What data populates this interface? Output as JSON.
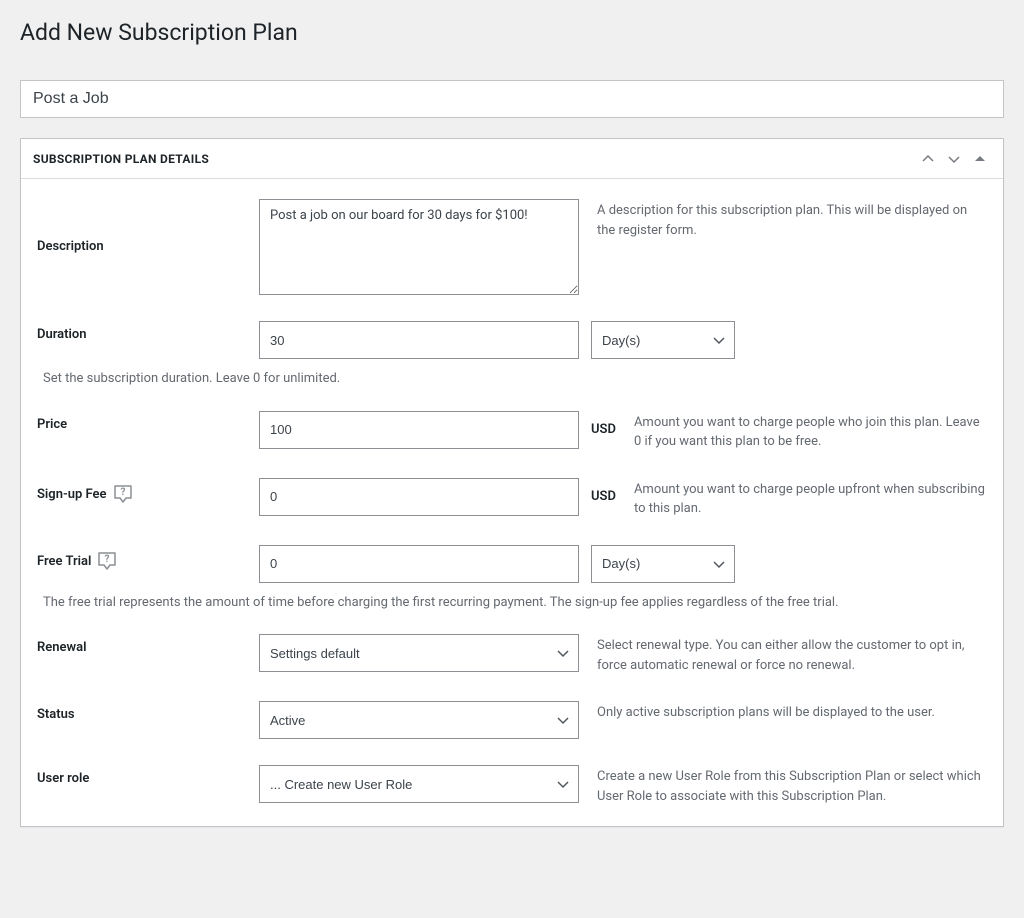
{
  "page": {
    "title": "Add New Subscription Plan"
  },
  "title_field": {
    "value": "Post a Job"
  },
  "panel": {
    "heading": "SUBSCRIPTION PLAN DETAILS"
  },
  "fields": {
    "description": {
      "label": "Description",
      "value": "Post a job on our board for 30 days for $100!",
      "help": "A description for this subscription plan. This will be displayed on the register form."
    },
    "duration": {
      "label": "Duration",
      "value": "30",
      "unit": "Day(s)",
      "subhelp": "Set the subscription duration. Leave 0 for unlimited."
    },
    "price": {
      "label": "Price",
      "value": "100",
      "currency": "USD",
      "help": "Amount you want to charge people who join this plan. Leave 0 if you want this plan to be free."
    },
    "signup_fee": {
      "label": "Sign-up Fee",
      "value": "0",
      "currency": "USD",
      "help": "Amount you want to charge people upfront when subscribing to this plan."
    },
    "free_trial": {
      "label": "Free Trial",
      "value": "0",
      "unit": "Day(s)",
      "subhelp": "The free trial represents the amount of time before charging the first recurring payment. The sign-up fee applies regardless of the free trial."
    },
    "renewal": {
      "label": "Renewal",
      "value": "Settings default",
      "help": "Select renewal type. You can either allow the customer to opt in, force automatic renewal or force no renewal."
    },
    "status": {
      "label": "Status",
      "value": "Active",
      "help": "Only active subscription plans will be displayed to the user."
    },
    "user_role": {
      "label": "User role",
      "value": "... Create new User Role",
      "help": "Create a new User Role from this Subscription Plan or select which User Role to associate with this Subscription Plan."
    }
  }
}
